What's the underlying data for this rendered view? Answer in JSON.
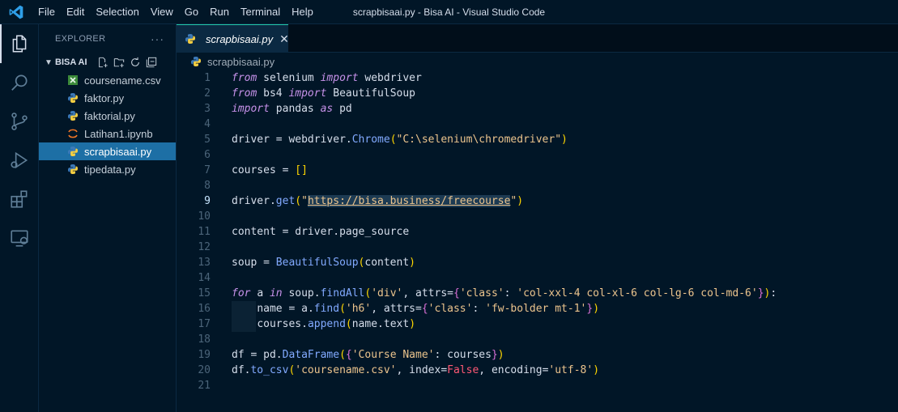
{
  "window": {
    "title": "scrapbisaai.py - Bisa AI - Visual Studio Code",
    "menu": [
      "File",
      "Edit",
      "Selection",
      "View",
      "Go",
      "Run",
      "Terminal",
      "Help"
    ]
  },
  "activity_bar": {
    "items": [
      "explorer-icon",
      "search-icon",
      "source-control-icon",
      "run-debug-icon",
      "extensions-icon",
      "remote-explorer-icon"
    ]
  },
  "sidebar": {
    "header": "EXPLORER",
    "more": "···",
    "folder": "BISA AI",
    "files": [
      {
        "name": "coursename.csv",
        "icon": "csv-file-icon",
        "selected": false
      },
      {
        "name": "faktor.py",
        "icon": "python-file-icon",
        "selected": false
      },
      {
        "name": "faktorial.py",
        "icon": "python-file-icon",
        "selected": false
      },
      {
        "name": "Latihan1.ipynb",
        "icon": "jupyter-file-icon",
        "selected": false
      },
      {
        "name": "scrapbisaai.py",
        "icon": "python-file-icon",
        "selected": true
      },
      {
        "name": "tipedata.py",
        "icon": "python-file-icon",
        "selected": false
      }
    ]
  },
  "editor": {
    "tab": {
      "label": "scrapbisaai.py",
      "close": "✕"
    },
    "breadcrumb": "scrapbisaai.py",
    "active_line": 9,
    "line_numbers": [
      "1",
      "2",
      "3",
      "4",
      "5",
      "6",
      "7",
      "8",
      "9",
      "10",
      "11",
      "12",
      "13",
      "14",
      "15",
      "16",
      "17",
      "18",
      "19",
      "20",
      "21"
    ],
    "lines": [
      "from selenium import webdriver",
      "from bs4 import BeautifulSoup",
      "import pandas as pd",
      "",
      "driver = webdriver.Chrome(\"C:\\selenium\\chromedriver\")",
      "",
      "courses = []",
      "",
      "driver.get(\"https://bisa.business/freecourse\")",
      "",
      "content = driver.page_source",
      "",
      "soup = BeautifulSoup(content)",
      "",
      "for a in soup.findAll('div', attrs={'class': 'col-xxl-4 col-xl-6 col-lg-6 col-md-6'}):",
      "    name = a.find('h6', attrs={'class': 'fw-bolder mt-1'})",
      "    courses.append(name.text)",
      "",
      "df = pd.DataFrame({'Course Name': courses})",
      "df.to_csv('coursename.csv', index=False, encoding='utf-8')",
      ""
    ]
  },
  "colors": {
    "background": "#011627",
    "keyword": "#c792ea",
    "string": "#ecc48d",
    "function": "#82aaff",
    "selection": "#1d6fa5",
    "boolean": "#ff5874"
  }
}
